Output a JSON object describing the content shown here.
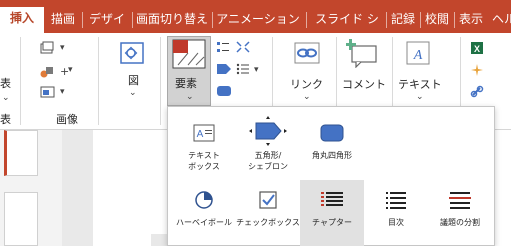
{
  "tabs": [
    "挿入",
    "描画",
    "デザイン",
    "画面切り替え",
    "アニメーション",
    "スライド ショー",
    "記録",
    "校閲",
    "表示",
    "ヘルプ"
  ],
  "ribbon": {
    "left_fragment_1": "表",
    "left_fragment_2": "表",
    "image_group_label": "画像",
    "picture_button": "図",
    "elements_button": "要素",
    "link_button": "リンク",
    "comment_button": "コメント",
    "text_button": "テキスト"
  },
  "dropdown": {
    "row1": [
      {
        "label": "テキスト\nボックス",
        "icon": "textbox-icon"
      },
      {
        "label": "五角形/\nシェブロン",
        "icon": "pentagon-icon"
      },
      {
        "label": "角丸四角形",
        "icon": "rounded-rect-icon"
      }
    ],
    "row2": [
      {
        "label": "ハーベイボール",
        "icon": "harvey-ball-icon"
      },
      {
        "label": "チェックボックス",
        "icon": "checkbox-icon"
      },
      {
        "label": "チャプター",
        "icon": "chapter-icon",
        "selected": true
      },
      {
        "label": "目次",
        "icon": "toc-icon"
      },
      {
        "label": "議題の分割",
        "icon": "agenda-split-icon"
      }
    ]
  },
  "colors": {
    "accent": "#c2462c",
    "brand_text": "#b7472a",
    "dropdown_selected": "#e1e1e1",
    "icon_blue": "#4472c4"
  }
}
